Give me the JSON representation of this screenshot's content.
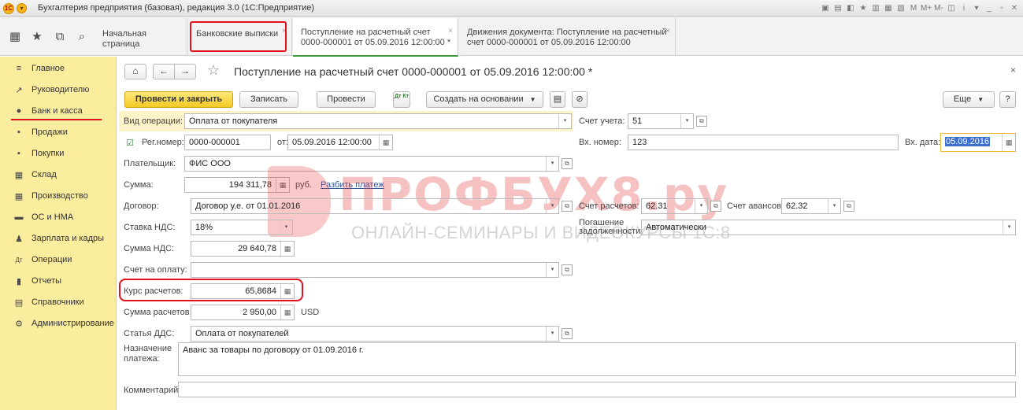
{
  "titlebar": {
    "logo": "1С",
    "title": "Бухгалтерия предприятия (базовая), редакция 3.0  (1С:Предприятие)",
    "icons": [
      "▣",
      "▤",
      "◧",
      "★",
      "▥",
      "▦",
      "▧",
      "M",
      "M+",
      "M-",
      "◫",
      "i",
      "▾",
      "_",
      "▫",
      "✕"
    ]
  },
  "top": {
    "tabs": [
      {
        "label": "Начальная страница"
      },
      {
        "label": "Банковские выписки",
        "close": "×"
      },
      {
        "label": "Поступление на расчетный счет 0000-000001 от 05.09.2016 12:00:00 *",
        "close": "×"
      },
      {
        "label": "Движения документа: Поступление на расчетный счет 0000-000001 от 05.09.2016 12:00:00",
        "close": "×"
      }
    ]
  },
  "sidebar": {
    "items": [
      {
        "label": "Главное",
        "icon": "≡"
      },
      {
        "label": "Руководителю",
        "icon": "↗"
      },
      {
        "label": "Банк и касса",
        "icon": "●"
      },
      {
        "label": "Продажи",
        "icon": "▪"
      },
      {
        "label": "Покупки",
        "icon": "▪"
      },
      {
        "label": "Склад",
        "icon": "▦"
      },
      {
        "label": "Производство",
        "icon": "▦"
      },
      {
        "label": "ОС и НМА",
        "icon": "▬"
      },
      {
        "label": "Зарплата и кадры",
        "icon": "♟"
      },
      {
        "label": "Операции",
        "icon": "Дт"
      },
      {
        "label": "Отчеты",
        "icon": "▮"
      },
      {
        "label": "Справочники",
        "icon": "▤"
      },
      {
        "label": "Администрирование",
        "icon": "⚙"
      }
    ]
  },
  "form": {
    "title": "Поступление на расчетный счет 0000-000001 от 05.09.2016 12:00:00 *",
    "close": "×",
    "toolbar": {
      "post_close": "Провести и закрыть",
      "save": "Записать",
      "post": "Провести",
      "dtkt": "Дт Кт",
      "create_basis": "Создать на основании",
      "more": "Еще",
      "help": "?"
    },
    "fields": {
      "vid_oper_label": "Вид операции:",
      "vid_oper": "Оплата от покупателя",
      "schet_ucheta_label": "Счет учета:",
      "schet_ucheta": "51",
      "regnomer_label": "Рег.номер:",
      "regnomer": "0000-000001",
      "ot_label": "от:",
      "ot": "05.09.2016 12:00:00",
      "vx_nomer_label": "Вх. номер:",
      "vx_nomer": "123",
      "vx_data_label": "Вх. дата:",
      "vx_data": "05.09.2016",
      "platelshchik_label": "Плательщик:",
      "platelshchik": "ФИС ООО",
      "summa_label": "Сумма:",
      "summa": "194 311,78",
      "summa_currency": "руб.",
      "razbit": "Разбить платеж",
      "dogovor_label": "Договор:",
      "dogovor": "Договор у.е. от 01.01.2016",
      "schet_raschetov_label": "Счет расчетов:",
      "schet_raschetov": "62.31",
      "schet_avansov_label": "Счет авансов:",
      "schet_avansov": "62.32",
      "stavka_nds_label": "Ставка НДС:",
      "stavka_nds": "18%",
      "pogashenie_label": "Погашение задолженности:",
      "pogashenie": "Автоматически",
      "summa_nds_label": "Сумма НДС:",
      "summa_nds": "29 640,78",
      "schet_na_oplatu_label": "Счет на оплату:",
      "schet_na_oplatu": "",
      "kurs_label": "Курс расчетов:",
      "kurs": "65,8684",
      "summa_raschetov_label": "Сумма расчетов:",
      "summa_raschetov": "2 950,00",
      "summa_raschetov_currency": "USD",
      "statya_dds_label": "Статья ДДС:",
      "statya_dds": "Оплата от покупателей",
      "naznachenie_label": "Назначение платежа:",
      "naznachenie": "Аванс за товары по договору от 01.09.2016 г.",
      "kommentariy_label": "Комментарий:",
      "kommentariy": ""
    }
  },
  "watermark": {
    "main": "ПРОФБУХ8.ру",
    "sub": "ОНЛАЙН-СЕМИНАРЫ И ВИДЕОКУРСЫ 1С:8"
  },
  "colors": {
    "accent_red": "#e2101b",
    "sidebar_bg": "#fbed9e",
    "primary_button": "#f3c926",
    "active_tab_underline": "#3a9a3a",
    "link": "#2b55a5"
  }
}
